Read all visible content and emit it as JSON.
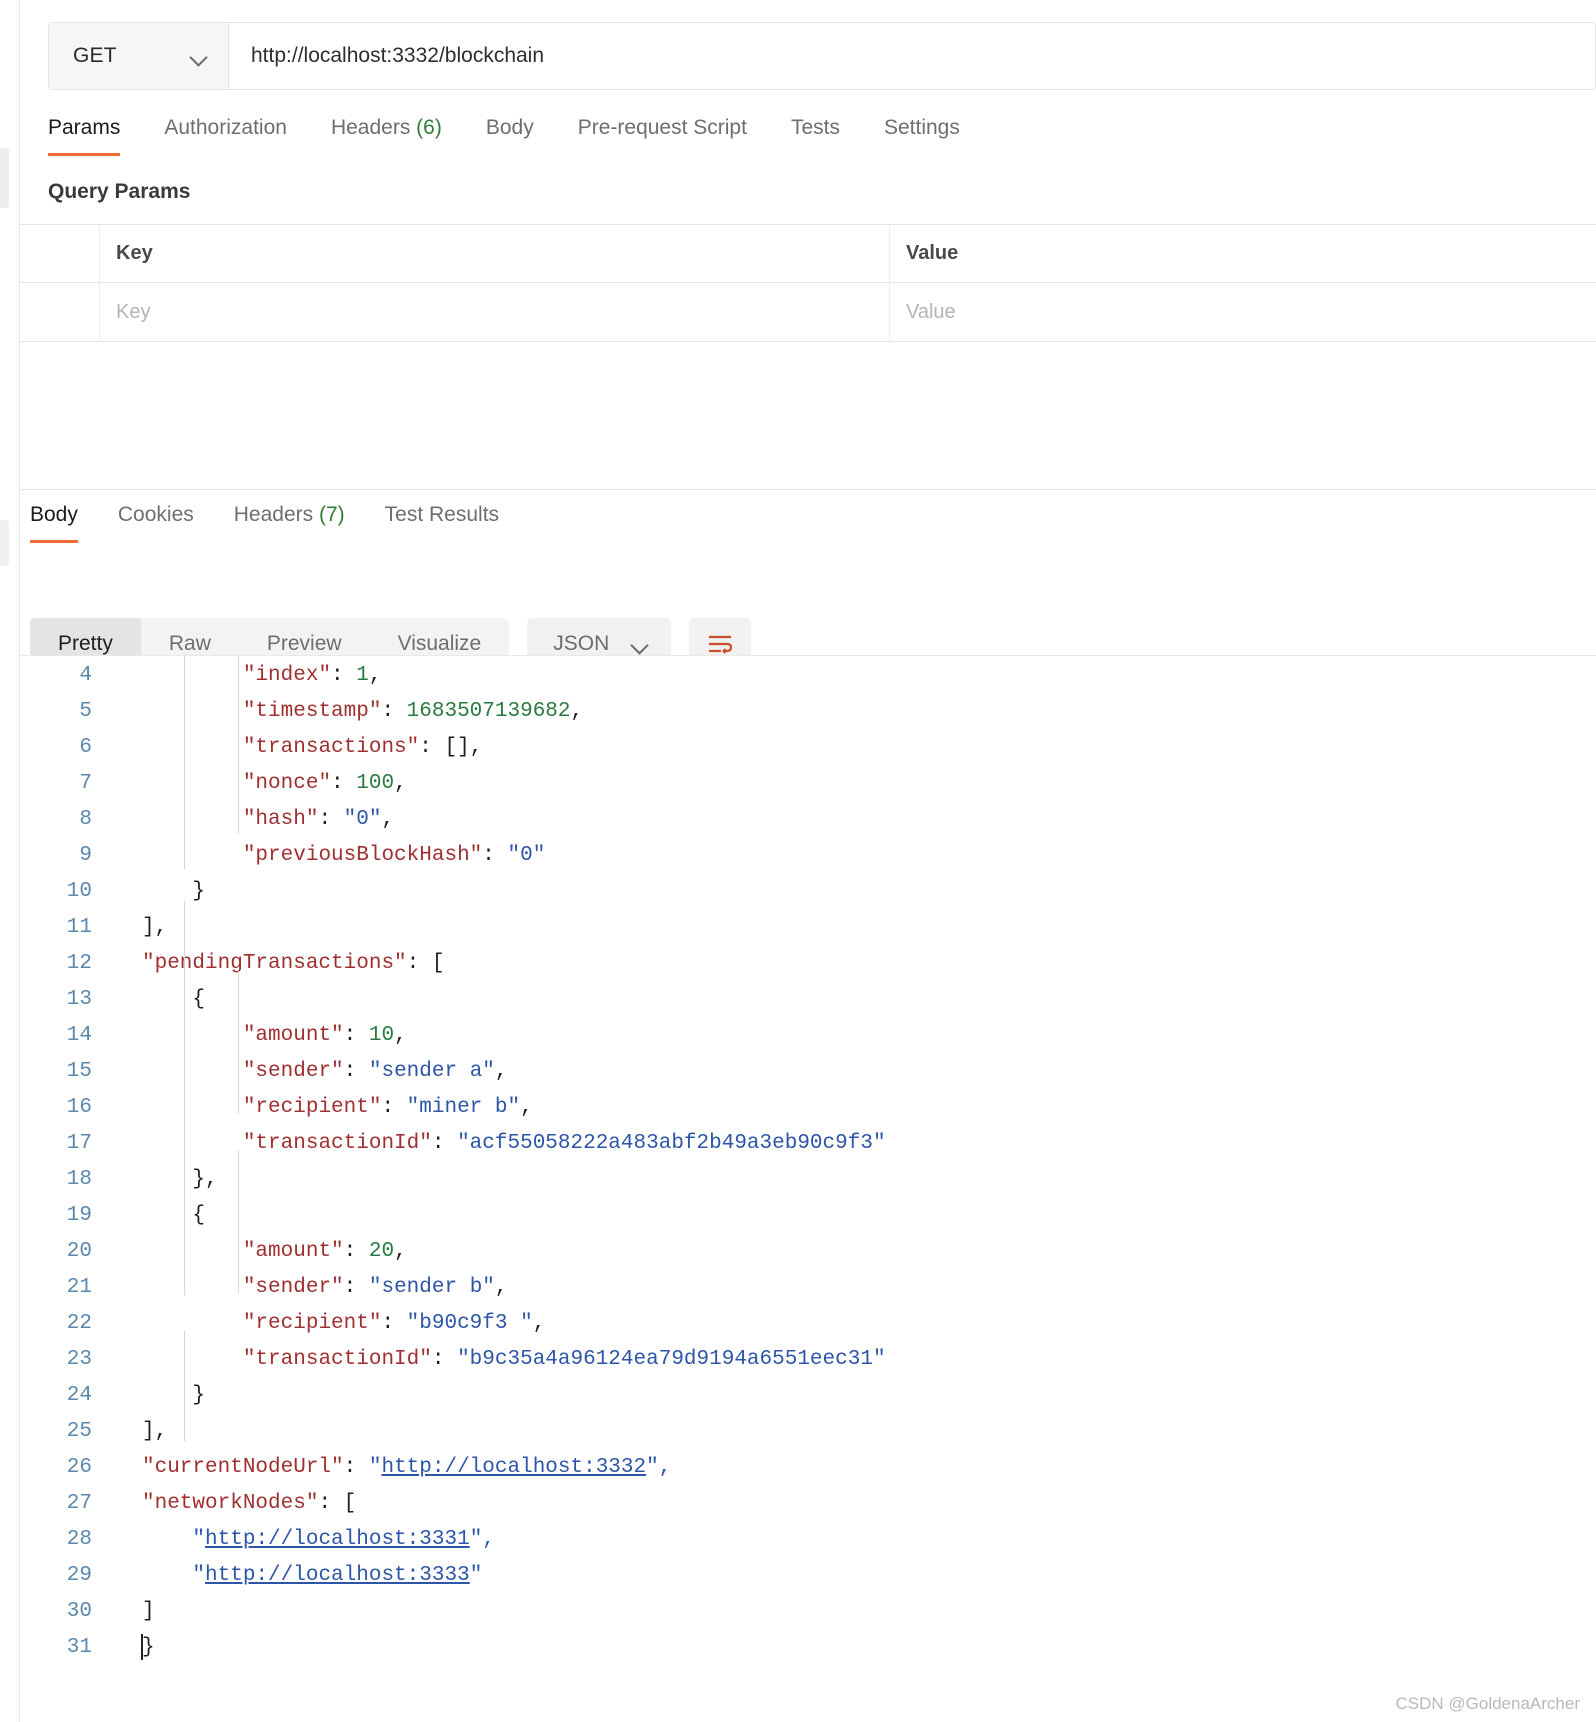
{
  "request": {
    "method": "GET",
    "url": "http://localhost:3332/blockchain",
    "tabs": [
      {
        "label": "Params",
        "active": true
      },
      {
        "label": "Authorization",
        "active": false
      },
      {
        "label": "Headers",
        "count": "(6)",
        "active": false
      },
      {
        "label": "Body",
        "active": false
      },
      {
        "label": "Pre-request Script",
        "active": false
      },
      {
        "label": "Tests",
        "active": false
      },
      {
        "label": "Settings",
        "active": false
      }
    ],
    "query_params": {
      "section_title": "Query Params",
      "columns": [
        "Key",
        "Value"
      ],
      "rows": [
        {
          "key_placeholder": "Key",
          "value_placeholder": "Value"
        }
      ]
    }
  },
  "response": {
    "tabs": [
      {
        "label": "Body",
        "active": true
      },
      {
        "label": "Cookies",
        "active": false
      },
      {
        "label": "Headers",
        "count": "(7)",
        "active": false
      },
      {
        "label": "Test Results",
        "active": false
      }
    ],
    "view_modes": [
      {
        "label": "Pretty",
        "active": true
      },
      {
        "label": "Raw",
        "active": false
      },
      {
        "label": "Preview",
        "active": false
      },
      {
        "label": "Visualize",
        "active": false
      }
    ],
    "format": "JSON",
    "wrap_icon": "wrap-lines-icon",
    "chevron_icon": "chevron-down-icon",
    "body_lines": [
      {
        "n": "4",
        "tokens": [
          {
            "t": "        ",
            "c": "pun"
          },
          {
            "t": "\"index\"",
            "c": "key"
          },
          {
            "t": ": ",
            "c": "pun"
          },
          {
            "t": "1",
            "c": "num"
          },
          {
            "t": ",",
            "c": "pun"
          }
        ]
      },
      {
        "n": "5",
        "tokens": [
          {
            "t": "        ",
            "c": "pun"
          },
          {
            "t": "\"timestamp\"",
            "c": "key"
          },
          {
            "t": ": ",
            "c": "pun"
          },
          {
            "t": "1683507139682",
            "c": "num"
          },
          {
            "t": ",",
            "c": "pun"
          }
        ]
      },
      {
        "n": "6",
        "tokens": [
          {
            "t": "        ",
            "c": "pun"
          },
          {
            "t": "\"transactions\"",
            "c": "key"
          },
          {
            "t": ": ",
            "c": "pun"
          },
          {
            "t": "[],",
            "c": "pun"
          }
        ]
      },
      {
        "n": "7",
        "tokens": [
          {
            "t": "        ",
            "c": "pun"
          },
          {
            "t": "\"nonce\"",
            "c": "key"
          },
          {
            "t": ": ",
            "c": "pun"
          },
          {
            "t": "100",
            "c": "num"
          },
          {
            "t": ",",
            "c": "pun"
          }
        ]
      },
      {
        "n": "8",
        "tokens": [
          {
            "t": "        ",
            "c": "pun"
          },
          {
            "t": "\"hash\"",
            "c": "key"
          },
          {
            "t": ": ",
            "c": "pun"
          },
          {
            "t": "\"0\"",
            "c": "str"
          },
          {
            "t": ",",
            "c": "pun"
          }
        ]
      },
      {
        "n": "9",
        "tokens": [
          {
            "t": "        ",
            "c": "pun"
          },
          {
            "t": "\"previousBlockHash\"",
            "c": "key"
          },
          {
            "t": ": ",
            "c": "pun"
          },
          {
            "t": "\"0\"",
            "c": "str"
          }
        ]
      },
      {
        "n": "10",
        "tokens": [
          {
            "t": "    }",
            "c": "pun"
          }
        ]
      },
      {
        "n": "11",
        "tokens": [
          {
            "t": "],",
            "c": "pun"
          }
        ]
      },
      {
        "n": "12",
        "tokens": [
          {
            "t": "\"pendingTransactions\"",
            "c": "key"
          },
          {
            "t": ": [",
            "c": "pun"
          }
        ]
      },
      {
        "n": "13",
        "tokens": [
          {
            "t": "    {",
            "c": "pun"
          }
        ]
      },
      {
        "n": "14",
        "tokens": [
          {
            "t": "        ",
            "c": "pun"
          },
          {
            "t": "\"amount\"",
            "c": "key"
          },
          {
            "t": ": ",
            "c": "pun"
          },
          {
            "t": "10",
            "c": "num"
          },
          {
            "t": ",",
            "c": "pun"
          }
        ]
      },
      {
        "n": "15",
        "tokens": [
          {
            "t": "        ",
            "c": "pun"
          },
          {
            "t": "\"sender\"",
            "c": "key"
          },
          {
            "t": ": ",
            "c": "pun"
          },
          {
            "t": "\"sender a\"",
            "c": "str"
          },
          {
            "t": ",",
            "c": "pun"
          }
        ]
      },
      {
        "n": "16",
        "tokens": [
          {
            "t": "        ",
            "c": "pun"
          },
          {
            "t": "\"recipient\"",
            "c": "key"
          },
          {
            "t": ": ",
            "c": "pun"
          },
          {
            "t": "\"miner b\"",
            "c": "str"
          },
          {
            "t": ",",
            "c": "pun"
          }
        ]
      },
      {
        "n": "17",
        "tokens": [
          {
            "t": "        ",
            "c": "pun"
          },
          {
            "t": "\"transactionId\"",
            "c": "key"
          },
          {
            "t": ": ",
            "c": "pun"
          },
          {
            "t": "\"acf55058222a483abf2b49a3eb90c9f3\"",
            "c": "str"
          }
        ]
      },
      {
        "n": "18",
        "tokens": [
          {
            "t": "    },",
            "c": "pun"
          }
        ]
      },
      {
        "n": "19",
        "tokens": [
          {
            "t": "    {",
            "c": "pun"
          }
        ]
      },
      {
        "n": "20",
        "tokens": [
          {
            "t": "        ",
            "c": "pun"
          },
          {
            "t": "\"amount\"",
            "c": "key"
          },
          {
            "t": ": ",
            "c": "pun"
          },
          {
            "t": "20",
            "c": "num"
          },
          {
            "t": ",",
            "c": "pun"
          }
        ]
      },
      {
        "n": "21",
        "tokens": [
          {
            "t": "        ",
            "c": "pun"
          },
          {
            "t": "\"sender\"",
            "c": "key"
          },
          {
            "t": ": ",
            "c": "pun"
          },
          {
            "t": "\"sender b\"",
            "c": "str"
          },
          {
            "t": ",",
            "c": "pun"
          }
        ]
      },
      {
        "n": "22",
        "tokens": [
          {
            "t": "        ",
            "c": "pun"
          },
          {
            "t": "\"recipient\"",
            "c": "key"
          },
          {
            "t": ": ",
            "c": "pun"
          },
          {
            "t": "\"b90c9f3 \"",
            "c": "str"
          },
          {
            "t": ",",
            "c": "pun"
          }
        ]
      },
      {
        "n": "23",
        "tokens": [
          {
            "t": "        ",
            "c": "pun"
          },
          {
            "t": "\"transactionId\"",
            "c": "key"
          },
          {
            "t": ": ",
            "c": "pun"
          },
          {
            "t": "\"b9c35a4a96124ea79d9194a6551eec31\"",
            "c": "str"
          }
        ]
      },
      {
        "n": "24",
        "tokens": [
          {
            "t": "    }",
            "c": "pun"
          }
        ]
      },
      {
        "n": "25",
        "tokens": [
          {
            "t": "],",
            "c": "pun"
          }
        ]
      },
      {
        "n": "26",
        "tokens": [
          {
            "t": "\"currentNodeUrl\"",
            "c": "key"
          },
          {
            "t": ": ",
            "c": "pun"
          },
          {
            "t": "\"",
            "c": "str"
          },
          {
            "t": "http://localhost:3332",
            "c": "link"
          },
          {
            "t": "\",",
            "c": "str"
          }
        ]
      },
      {
        "n": "27",
        "tokens": [
          {
            "t": "\"networkNodes\"",
            "c": "key"
          },
          {
            "t": ": [",
            "c": "pun"
          }
        ]
      },
      {
        "n": "28",
        "tokens": [
          {
            "t": "    ",
            "c": "pun"
          },
          {
            "t": "\"",
            "c": "str"
          },
          {
            "t": "http://localhost:3331",
            "c": "link"
          },
          {
            "t": "\",",
            "c": "str"
          }
        ]
      },
      {
        "n": "29",
        "tokens": [
          {
            "t": "    ",
            "c": "pun"
          },
          {
            "t": "\"",
            "c": "str"
          },
          {
            "t": "http://localhost:3333",
            "c": "link"
          },
          {
            "t": "\"",
            "c": "str"
          }
        ]
      },
      {
        "n": "30",
        "tokens": [
          {
            "t": "]",
            "c": "pun"
          }
        ]
      },
      {
        "n": "31",
        "tokens": [
          {
            "t": "}",
            "c": "pun"
          }
        ]
      }
    ]
  },
  "watermark": "CSDN @GoldenaArcher",
  "colors": {
    "accent": "#ef6c34",
    "count_green": "#2f7d32",
    "json_key": "#a03030",
    "json_number": "#2a7a40",
    "json_string": "#2d55a8",
    "gutter": "#5b87ad"
  }
}
